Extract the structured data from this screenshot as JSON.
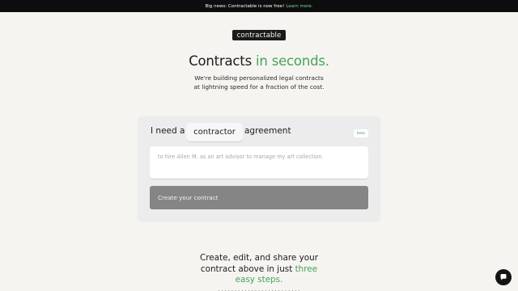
{
  "banner": {
    "text": "Big news: Contractable is now free!",
    "link": "Learn more."
  },
  "logo": {
    "text": "contractable"
  },
  "hero": {
    "title_main": "Contracts",
    "title_accent": "in seconds.",
    "subtitle_line1": "We're building personalized legal contracts",
    "subtitle_line2": "at lightning speed for a fraction of the cost."
  },
  "form": {
    "label_prefix": "I need a",
    "contract_type": "contractor",
    "label_suffix": "agreement",
    "badge": "beta",
    "input_placeholder": "to hire Allen M. as an art advisor to manage my art collection.",
    "submit_label": "Create your contract"
  },
  "steps": {
    "line1": "Create, edit, and share your",
    "line2_prefix": "contract above in just",
    "line2_accent": "three",
    "line3_accent": "easy steps."
  },
  "chat": {
    "icon": "chat-bubble-icon"
  },
  "colors": {
    "accent_green": "#46a35a",
    "banner_bg": "#0d0d0d",
    "page_bg": "#f5f4f0",
    "button_gray": "#858585"
  }
}
